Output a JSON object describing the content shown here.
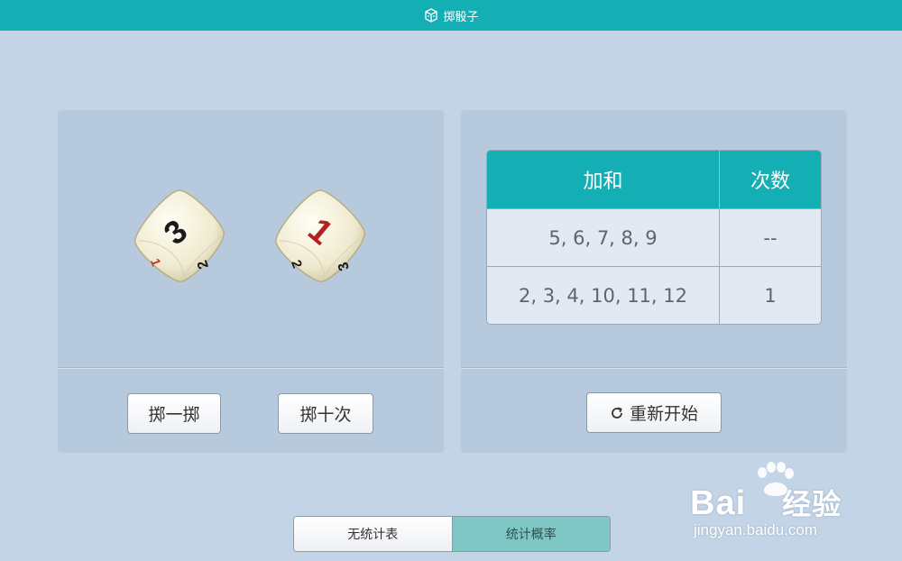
{
  "header": {
    "title": "掷骰子",
    "icon": "dice-box-icon",
    "color": "#14afb5"
  },
  "dice": [
    {
      "face_value": "3",
      "side_values": [
        "1",
        "2"
      ],
      "face_color": "#1a1a1a"
    },
    {
      "face_value": "1",
      "side_values": [
        "2",
        "3"
      ],
      "face_color": "#b52020"
    }
  ],
  "controls": {
    "roll_once": "掷一掷",
    "roll_ten": "掷十次",
    "restart": "重新开始",
    "restart_icon": "refresh-icon"
  },
  "stats_table": {
    "headers": [
      "加和",
      "次数"
    ],
    "rows": [
      {
        "sum": "5, 6, 7, 8, 9",
        "count": "--"
      },
      {
        "sum": "2, 3, 4, 10, 11, 12",
        "count": "1"
      }
    ]
  },
  "tabs": [
    {
      "label": "无统计表",
      "active": false
    },
    {
      "label": "统计概率",
      "active": true
    }
  ],
  "watermark": {
    "brand": "Bai",
    "brand_suffix": "经验",
    "url": "jingyan.baidu.com"
  }
}
